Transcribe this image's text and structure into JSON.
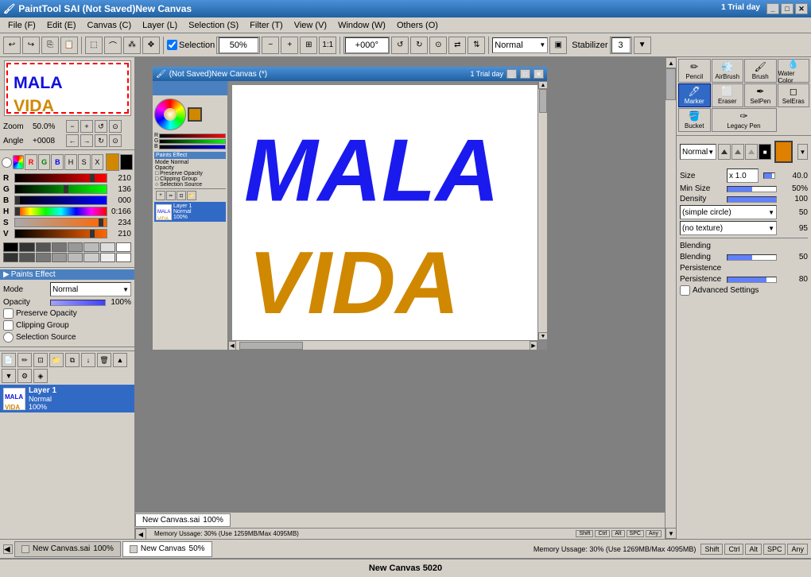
{
  "app": {
    "title": "PaintTool SAI  (Not Saved)New Canvas",
    "trial": "1 Trial day",
    "icon": "🖌️"
  },
  "menu": {
    "items": [
      "File (F)",
      "Edit (E)",
      "Canvas (C)",
      "Layer (L)",
      "Selection (S)",
      "Filter (T)",
      "View (V)",
      "Window (W)",
      "Others (O)"
    ]
  },
  "toolbar": {
    "selection_checked": true,
    "selection_label": "Selection",
    "zoom_value": "50%",
    "angle_value": "+000°",
    "normal_label": "Normal",
    "stabilizer_label": "Stabilizer",
    "stabilizer_value": "3"
  },
  "color": {
    "r_label": "R",
    "r_value": "210",
    "g_label": "G",
    "g_value": "136",
    "b_label": "B",
    "b_value": "000",
    "h_label": "H",
    "h_value": "0:166",
    "s_label": "S",
    "s_value": "234",
    "v_label": "V",
    "v_value": "210",
    "current": "#D08800"
  },
  "paints": {
    "header": "Paints Effect",
    "mode_label": "Mode",
    "mode_value": "Normal",
    "opacity_label": "Opacity",
    "opacity_value": "100%",
    "preserve_opacity": "Preserve Opacity",
    "clipping_group": "Clipping Group",
    "selection_source": "Selection Source"
  },
  "layers": {
    "layer1_name": "Layer 1",
    "layer1_mode": "Normal",
    "layer1_opacity": "100%"
  },
  "brush": {
    "tools": [
      {
        "id": "pencil",
        "label": "Pencil",
        "icon": "✏️"
      },
      {
        "id": "airbrush",
        "label": "AirBrush",
        "icon": "💨"
      },
      {
        "id": "brush",
        "label": "Brush",
        "icon": "🖌"
      },
      {
        "id": "watercolor",
        "label": "Water Color",
        "icon": "💧"
      },
      {
        "id": "marker",
        "label": "Marker",
        "icon": "🖊"
      },
      {
        "id": "eraser",
        "label": "Eraser",
        "icon": "⬜"
      },
      {
        "id": "selpen",
        "label": "SelPen",
        "icon": "✒"
      },
      {
        "id": "seleras",
        "label": "SelEras",
        "icon": "◻"
      },
      {
        "id": "bucket",
        "label": "Bucket",
        "icon": "🪣"
      },
      {
        "id": "legacy",
        "label": "Legacy Pen",
        "icon": "✑"
      }
    ],
    "active_tool": "marker",
    "mode_label": "Normal",
    "size_label": "Size",
    "size_mult": "x 1.0",
    "size_value": "40.0",
    "minsize_label": "Min Size",
    "minsize_value": "50%",
    "density_label": "Density",
    "density_value": "100",
    "shape_label": "(simple circle)",
    "shape_value": "50",
    "texture_label": "(no texture)",
    "texture_value": "95",
    "blending_label": "Blending",
    "blending_value": "50",
    "persistence_label": "Persistence",
    "persistence_value": "80"
  },
  "canvas": {
    "zoom": "50%",
    "tab_label": "New Canvas.sai",
    "tab2_label": "New Canvas",
    "tab2_zoom": "50%"
  },
  "inner_window": {
    "title": "(Not Saved)New Canvas (*)",
    "trial": "1 Trial day"
  },
  "status": {
    "memory": "Memory Ussage: 30% (Use 1269MB/Max 4095MB)",
    "shortcuts": [
      "Shift",
      "Ctrl",
      "Alt",
      "SPC",
      "Any"
    ]
  },
  "taskbar": {
    "tab1_label": "New Canvas.sai",
    "tab1_zoom": "100%",
    "tab2_label": "New Canvas",
    "tab2_zoom": "50%",
    "canvas_name": "New Canvas 5020"
  }
}
